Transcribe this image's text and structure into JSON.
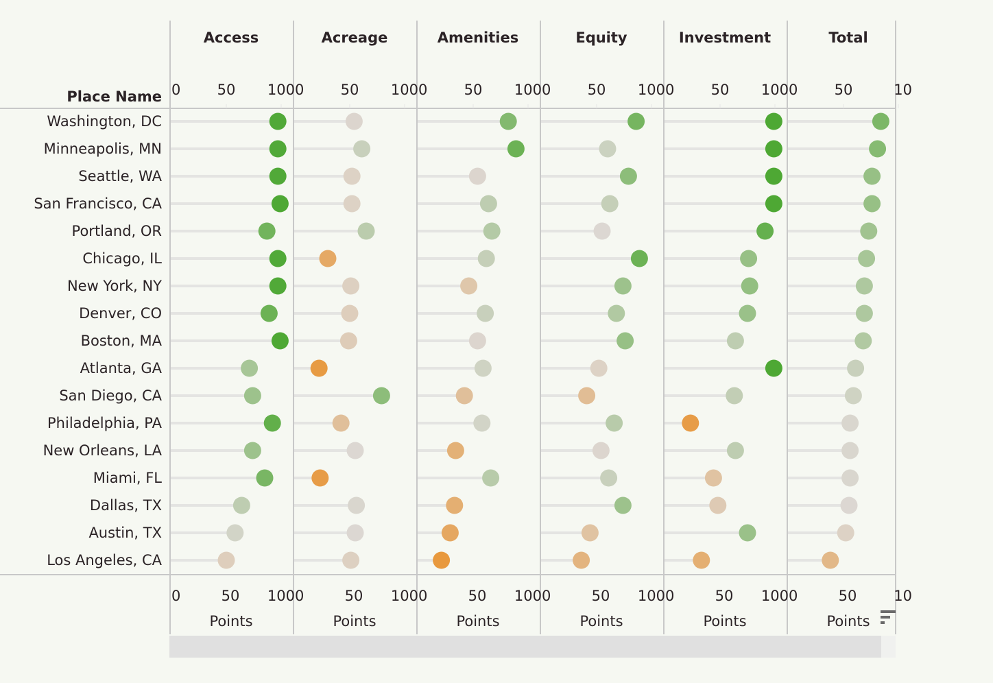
{
  "chart_data": {
    "type": "scatter",
    "subtype": "dot-plot-small-multiples",
    "row_header": "Place Name",
    "xlabel": "Points",
    "xlim": [
      0,
      100
    ],
    "ticks": [
      "0",
      "50",
      "100"
    ],
    "last_panel_ticks": [
      "0",
      "50",
      "10"
    ],
    "categories": [
      "Washington, DC",
      "Minneapolis, MN",
      "Seattle, WA",
      "San Francisco, CA",
      "Portland, OR",
      "Chicago, IL",
      "New York, NY",
      "Denver, CO",
      "Boston, MA",
      "Atlanta, GA",
      "San Diego, CA",
      "Philadelphia, PA",
      "New Orleans, LA",
      "Miami, FL",
      "Dallas, TX",
      "Austin, TX",
      "Los Angeles, CA"
    ],
    "series": [
      {
        "name": "Access",
        "values": [
          97,
          97,
          97,
          99,
          87,
          97,
          97,
          89,
          99,
          71,
          74,
          92,
          74,
          85,
          64,
          58,
          50
        ]
      },
      {
        "name": "Acreage",
        "values": [
          54,
          61,
          52,
          52,
          65,
          30,
          51,
          50,
          49,
          22,
          79,
          42,
          55,
          23,
          56,
          55,
          51
        ]
      },
      {
        "name": "Amenities",
        "values": [
          82,
          89,
          54,
          64,
          67,
          62,
          46,
          61,
          54,
          59,
          42,
          58,
          34,
          66,
          33,
          29,
          21
        ]
      },
      {
        "name": "Equity",
        "values": [
          86,
          60,
          79,
          62,
          55,
          89,
          74,
          68,
          76,
          52,
          41,
          66,
          54,
          61,
          74,
          44,
          36
        ]
      },
      {
        "name": "Investment",
        "values": [
          99,
          99,
          99,
          99,
          91,
          76,
          77,
          75,
          64,
          99,
          63,
          23,
          64,
          44,
          48,
          75,
          33
        ]
      },
      {
        "name": "Total",
        "values": [
          84,
          81,
          76,
          76,
          73,
          71,
          69,
          69,
          68,
          61,
          59,
          56,
          56,
          56,
          55,
          52,
          38
        ]
      }
    ],
    "color_scale": {
      "low": "#e8973a",
      "mid": "#dcd7d2",
      "high": "#4ea834"
    },
    "grid": false,
    "legend": "none"
  },
  "ui": {
    "scrollbar": "horizontal-scrollbar",
    "sort_icon": "sort-descending-icon"
  }
}
